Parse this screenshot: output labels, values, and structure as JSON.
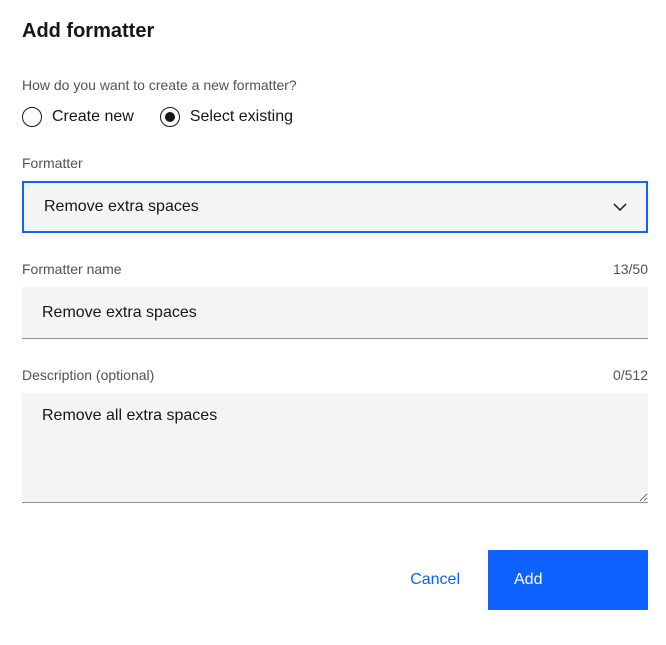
{
  "title": "Add formatter",
  "question": "How do you want to create a new formatter?",
  "radios": {
    "create_new": "Create new",
    "select_existing": "Select existing"
  },
  "formatter": {
    "label": "Formatter",
    "value": "Remove extra spaces"
  },
  "name": {
    "label": "Formatter name",
    "value": "Remove extra spaces",
    "counter": "13/50"
  },
  "description": {
    "label": "Description (optional)",
    "value": "Remove all extra spaces",
    "counter": "0/512"
  },
  "buttons": {
    "cancel": "Cancel",
    "add": "Add"
  }
}
